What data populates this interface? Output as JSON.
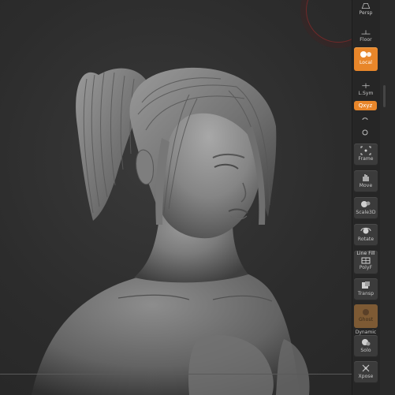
{
  "shelf": {
    "persp_label": "Persp",
    "floor_label": "Floor",
    "local_label": "Local",
    "lsym_label": "L.Sym",
    "xyz_label": "Qxyz",
    "frame_label": "Frame",
    "move_label": "Move",
    "scale_label": "Scale3D",
    "rotate_label": "Rotate",
    "linefill_label": "Line Fill",
    "polyf_label": "PolyF",
    "transp_label": "Transp",
    "ghost_label": "Ghost",
    "dynamic_label": "Dynamic",
    "solo_label": "Solo",
    "xpose_label": "Xpose"
  },
  "colors": {
    "accent": "#e8862a",
    "shelf_bg": "#262626",
    "viewport_bg": "#2e2e2e",
    "gizmo": "#9e2b2b"
  },
  "icons": {
    "persp": "perspective-icon",
    "floor": "floor-grid-icon",
    "local": "local-transform-icon",
    "lsym": "local-symmetry-icon",
    "xyz": "xyz-rotation-icon",
    "frame": "frame-icon",
    "move": "move-hand-icon",
    "scale": "scale-icon",
    "rotate": "rotate-icon",
    "polyf": "polyframe-icon",
    "transp": "transparency-icon",
    "ghost": "ghost-icon",
    "solo": "solo-icon",
    "xpose": "xpose-icon"
  }
}
